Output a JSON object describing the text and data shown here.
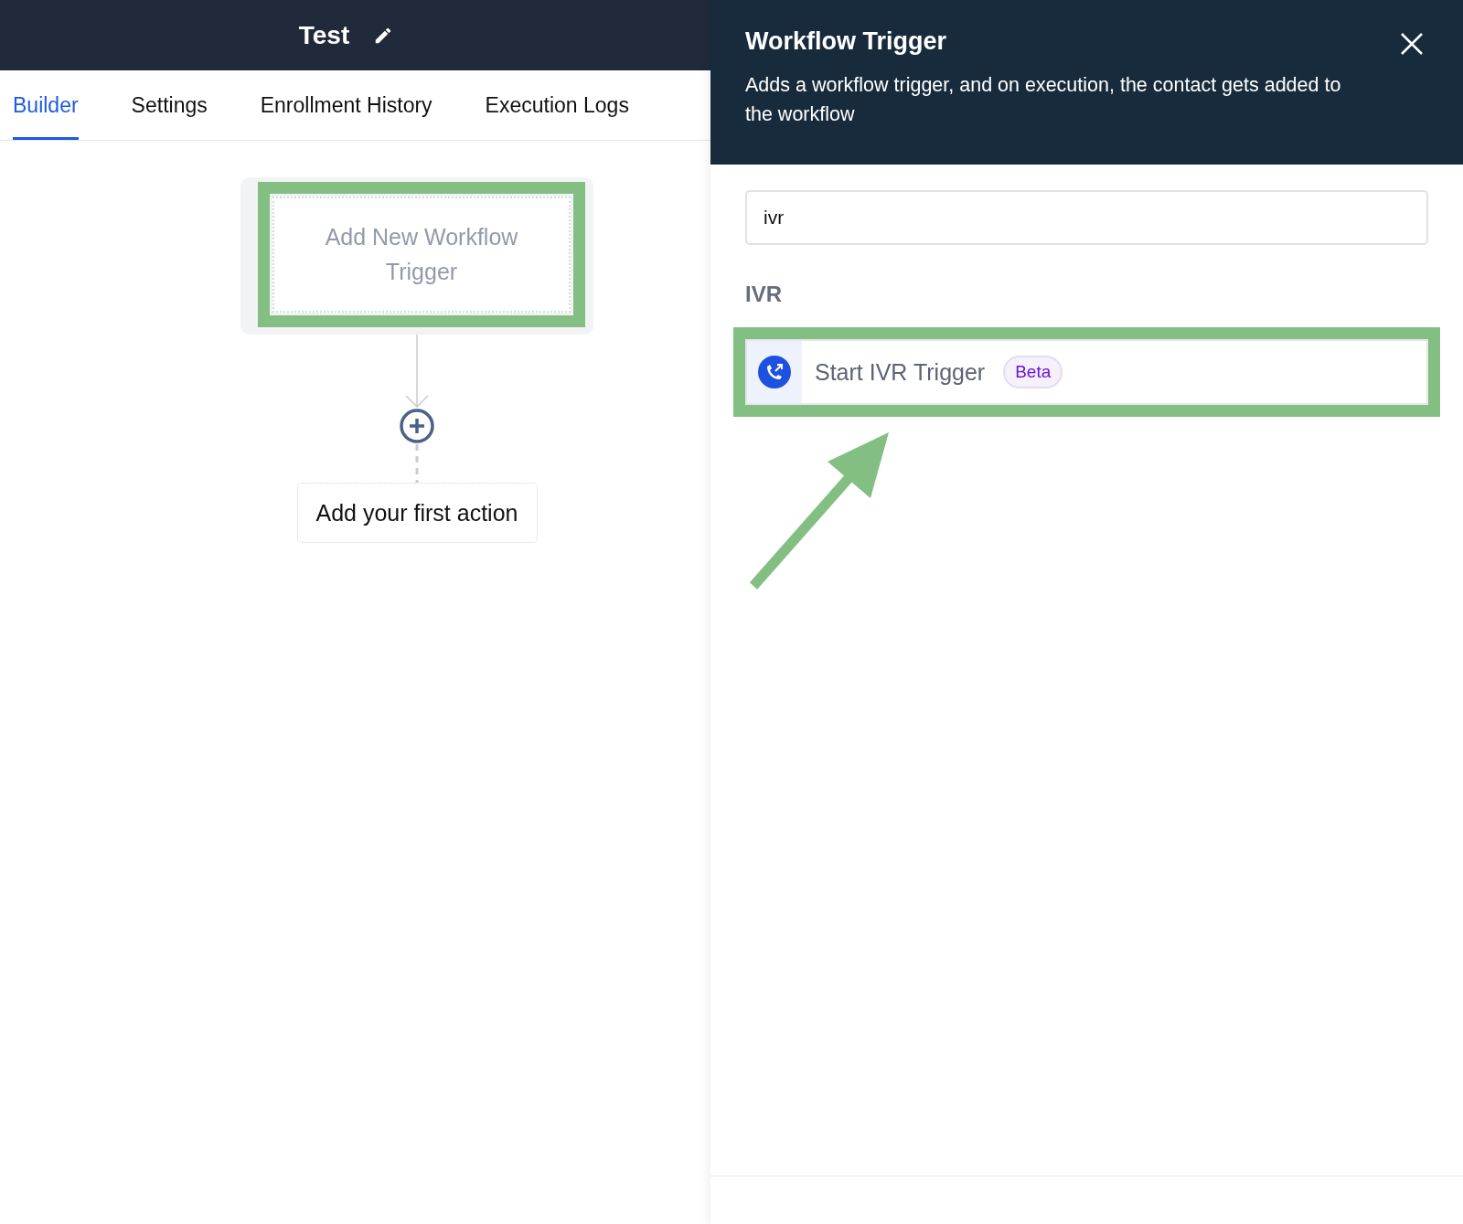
{
  "header": {
    "title": "Test"
  },
  "tabs": [
    {
      "label": "Builder",
      "selected": true
    },
    {
      "label": "Settings",
      "selected": false
    },
    {
      "label": "Enrollment History",
      "selected": false
    },
    {
      "label": "Execution Logs",
      "selected": false
    }
  ],
  "canvas": {
    "trigger_node": {
      "label": "Add New Workflow Trigger",
      "highlighted": true
    },
    "action_node": {
      "label": "Add your first action"
    }
  },
  "panel": {
    "title": "Workflow Trigger",
    "description": "Adds a workflow trigger, and on execution, the contact gets added to the workflow",
    "search": {
      "value": "ivr"
    },
    "groups": [
      {
        "heading": "IVR",
        "items": [
          {
            "label": "Start IVR Trigger",
            "badge": "Beta",
            "highlighted": true
          }
        ]
      }
    ]
  }
}
